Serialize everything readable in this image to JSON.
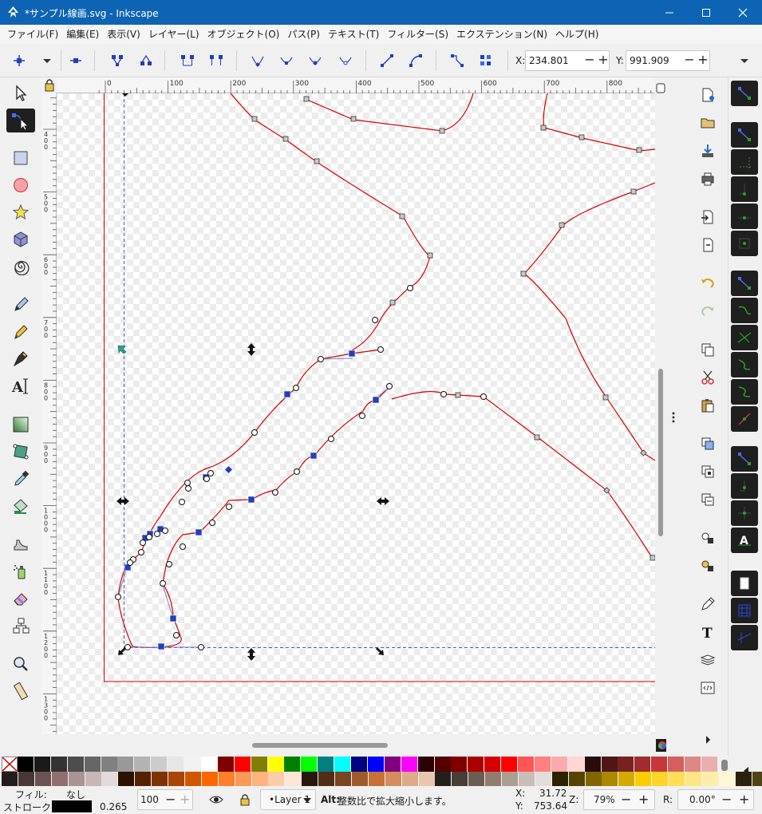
{
  "window": {
    "title": "*サンプル線画.svg - Inkscape"
  },
  "menu": [
    {
      "label": "ファイル(F)"
    },
    {
      "label": "編集(E)"
    },
    {
      "label": "表示(V)"
    },
    {
      "label": "レイヤー(L)"
    },
    {
      "label": "オブジェクト(O)"
    },
    {
      "label": "パス(P)"
    },
    {
      "label": "テキスト(T)"
    },
    {
      "label": "フィルター(S)"
    },
    {
      "label": "エクステンション(N)"
    },
    {
      "label": "ヘルプ(H)"
    }
  ],
  "tool_controls": {
    "x_label": "X:",
    "x_value": "234.801",
    "y_label": "Y:",
    "y_value": "991.909",
    "minus": "−",
    "plus": "+"
  },
  "ruler": {
    "top_ticks": [
      "0",
      "100",
      "200",
      "300",
      "400",
      "500",
      "600",
      "700",
      "800"
    ],
    "left_ticks": [
      "4\n0\n0",
      "5\n0\n0",
      "6\n0\n0",
      "7\n0\n0",
      "8\n0\n0",
      "9\n0\n0",
      "1\n0\n0\n0",
      "1\n1\n0\n0",
      "1\n2\n0\n0",
      "1\n3\n0\n0"
    ]
  },
  "colors": {
    "accent": "#0e64b4",
    "path_stroke": "#d40000",
    "node_selected": "#1f3fbf",
    "handle_line": "#7f7fd0"
  },
  "palette": {
    "row1": [
      "#000000",
      "#1a1a1a",
      "#333333",
      "#4d4d4d",
      "#666666",
      "#808080",
      "#999999",
      "#b3b3b3",
      "#cccccc",
      "#e6e6e6",
      "#f2f2f2",
      "#ffffff",
      "#800000",
      "#ff0000",
      "#808000",
      "#ffff00",
      "#008000",
      "#00ff00",
      "#008080",
      "#00ffff",
      "#000080",
      "#0000ff",
      "#800080",
      "#ff00ff",
      "#2b0000",
      "#550000",
      "#800000",
      "#aa0000",
      "#d40000",
      "#ff0000",
      "#ff5555",
      "#ff8080",
      "#ffaaaa",
      "#ffd5d5",
      "#280b0b",
      "#501616",
      "#782121",
      "#a02c2c",
      "#c83737",
      "#d35f5f",
      "#de8787",
      "#e9afaf"
    ],
    "row2": [
      "#241c1c",
      "#483737",
      "#6c5353",
      "#916f6f",
      "#ac9393",
      "#c8b7b7",
      "#e3dbdb",
      "#2b1100",
      "#552200",
      "#803300",
      "#aa4400",
      "#d45500",
      "#ff6600",
      "#ff7f2a",
      "#ff9955",
      "#ffb380",
      "#ffccaa",
      "#ffe6d5",
      "#28170b",
      "#502d16",
      "#784421",
      "#a05a2c",
      "#c87137",
      "#d38d5f",
      "#deaa87",
      "#e9c6af",
      "#241f1c",
      "#483e37",
      "#6c5d53",
      "#917c6f",
      "#ac9d93",
      "#c8beb7",
      "#e3dedb",
      "#2b2200",
      "#554400",
      "#806600",
      "#aa8800",
      "#d4aa00",
      "#ffcc00",
      "#ffd42a",
      "#ffdd55",
      "#ffe680",
      "#ffeeaa",
      "#fff6d5",
      "#28220b",
      "#504416"
    ]
  },
  "status": {
    "fill_label": "フィル:",
    "fill_value": "なし",
    "stroke_label": "ストローク:",
    "stroke_width": "0.265",
    "opacity_label": "O:",
    "opacity_value": "100",
    "layer_name": "•Layer 1",
    "message_bold": "Alt:",
    "message": " 整数比で拡大縮小します。",
    "cursor_x_label": "X:",
    "cursor_x": "31.72",
    "cursor_y_label": "Y:",
    "cursor_y": "753.64",
    "zoom_label": "Z:",
    "zoom_value": "79%",
    "rotate_label": "R:",
    "rotate_value": "0.00°"
  }
}
